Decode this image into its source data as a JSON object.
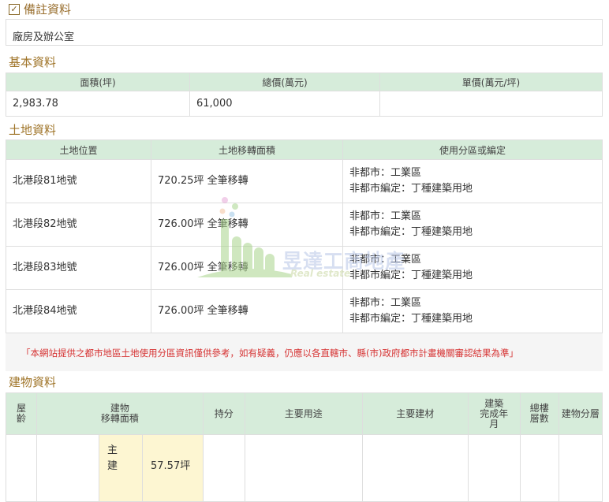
{
  "remark": {
    "title": "備註資料",
    "content": "廠房及辦公室"
  },
  "basic": {
    "title": "基本資料",
    "headers": [
      "面積(坪)",
      "總價(萬元)",
      "單價(萬元/坪)"
    ],
    "values": [
      "2,983.78",
      "61,000",
      ""
    ]
  },
  "land": {
    "title": "土地資料",
    "headers": [
      "土地位置",
      "土地移轉面積",
      "使用分區或編定"
    ],
    "rows": [
      {
        "location": "北港段81地號",
        "area": "720.25坪 全筆移轉",
        "zone1": "非都市：工業區",
        "zone2": "非都市編定：丁種建築用地"
      },
      {
        "location": "北港段82地號",
        "area": "726.00坪 全筆移轉",
        "zone1": "非都市：工業區",
        "zone2": "非都市編定：丁種建築用地"
      },
      {
        "location": "北港段83地號",
        "area": "726.00坪 全筆移轉",
        "zone1": "非都市：工業區",
        "zone2": "非都市編定：丁種建築用地"
      },
      {
        "location": "北港段84地號",
        "area": "726.00坪 全筆移轉",
        "zone1": "非都市：工業區",
        "zone2": "非都市編定：丁種建築用地"
      }
    ]
  },
  "notice": "「本網站提供之都市地區土地使用分區資訊僅供參考，如有疑義，仍應以各直轄市、縣(市)政府都市計畫機關審認結果為準」",
  "building": {
    "title": "建物資料",
    "headers": {
      "age": "屋齡",
      "area_line1": "建物",
      "area_line2": "移轉面積",
      "share": "持分",
      "use": "主要用途",
      "material": "主要建材",
      "completed_line1": "建築",
      "completed_line2": "完成年",
      "completed_line3": "月",
      "floors_line1": "總樓",
      "floors_line2": "層數",
      "layer": "建物分層"
    },
    "row": {
      "type_line1": "主",
      "type_line2": "建",
      "area": "57.57坪"
    }
  },
  "watermark": {
    "name": "昱達工商地產",
    "sub": "Real estate"
  }
}
